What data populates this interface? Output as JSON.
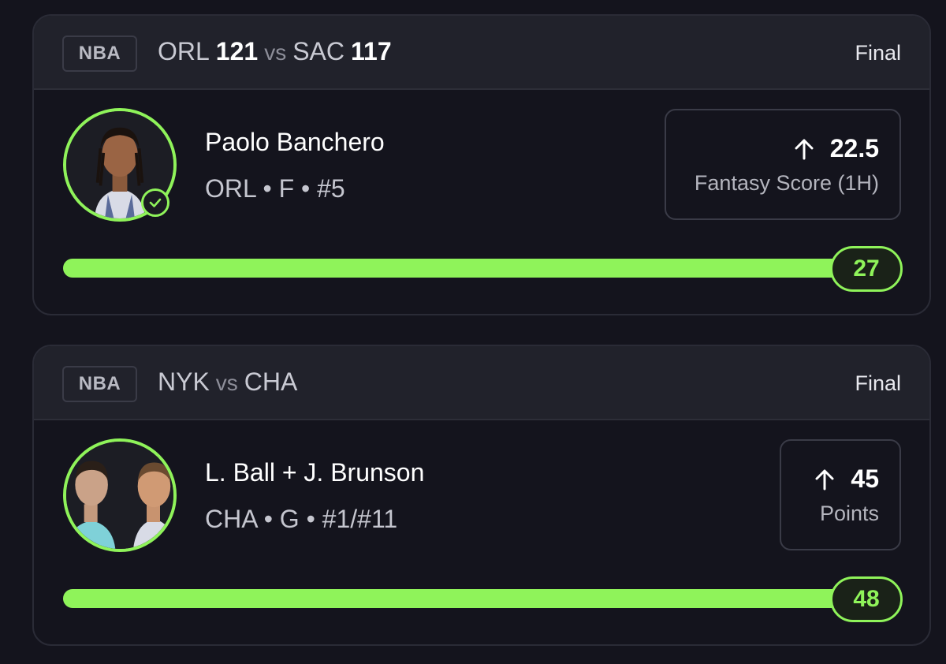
{
  "cards": [
    {
      "league": "NBA",
      "matchup": {
        "team1": "ORL",
        "score1": "121",
        "vs": "vs",
        "team2": "SAC",
        "score2": "117"
      },
      "status": "Final",
      "player": {
        "name": "Paolo Banchero",
        "meta": "ORL • F • #5",
        "avatar": "player-headshot",
        "verified": true
      },
      "stat": {
        "direction_icon": "arrow-up-icon",
        "value": "22.5",
        "label": "Fantasy Score (1H)"
      },
      "result": {
        "value": "27",
        "progress": 1.0
      }
    },
    {
      "league": "NBA",
      "matchup": {
        "team1": "NYK",
        "score1": "",
        "vs": "vs",
        "team2": "CHA",
        "score2": ""
      },
      "status": "Final",
      "player": {
        "name": "L. Ball + J. Brunson",
        "meta": "CHA • G • #1/#11",
        "avatar": "combo-player-headshot",
        "verified": false
      },
      "stat": {
        "direction_icon": "arrow-up-icon",
        "value": "45",
        "label": "Points"
      },
      "result": {
        "value": "48",
        "progress": 1.0
      }
    }
  ],
  "colors": {
    "accent": "#8ff35a",
    "background": "#14141d",
    "header": "#21222b"
  }
}
